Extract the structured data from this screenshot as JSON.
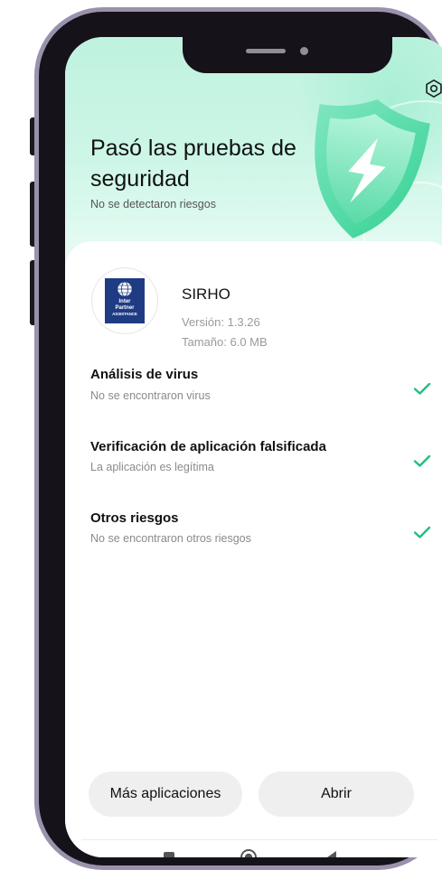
{
  "header": {
    "title": "Pasó las pruebas de seguridad",
    "subtitle": "No se detectaron riesgos"
  },
  "app": {
    "name": "SIRHO",
    "version": "Versión: 1.3.26",
    "size": "Tamaño: 6.0 MB",
    "logo_text": [
      "Inter",
      "Partner",
      "ASSISTANCE"
    ]
  },
  "checks": [
    {
      "title": "Análisis de virus",
      "subtitle": "No se encontraron virus",
      "status": "passed"
    },
    {
      "title": "Verificación de aplicación falsificada",
      "subtitle": "La aplicación es legítima",
      "status": "passed"
    },
    {
      "title": "Otros riesgos",
      "subtitle": "No se encontraron otros riesgos",
      "status": "passed"
    }
  ],
  "actions": {
    "more_apps": "Más aplicaciones",
    "open": "Abrir"
  },
  "icons": {
    "settings": "settings-icon",
    "shield": "shield-lightning-icon",
    "check": "check-icon",
    "nav_recents": "square-icon",
    "nav_home": "circle-icon",
    "nav_back": "back-triangle-icon"
  },
  "colors": {
    "accent_green": "#1fbf7f",
    "hero_bg": "#c9f4e4",
    "button_bg": "#efefef",
    "phone_frame": "#9a92ad"
  }
}
